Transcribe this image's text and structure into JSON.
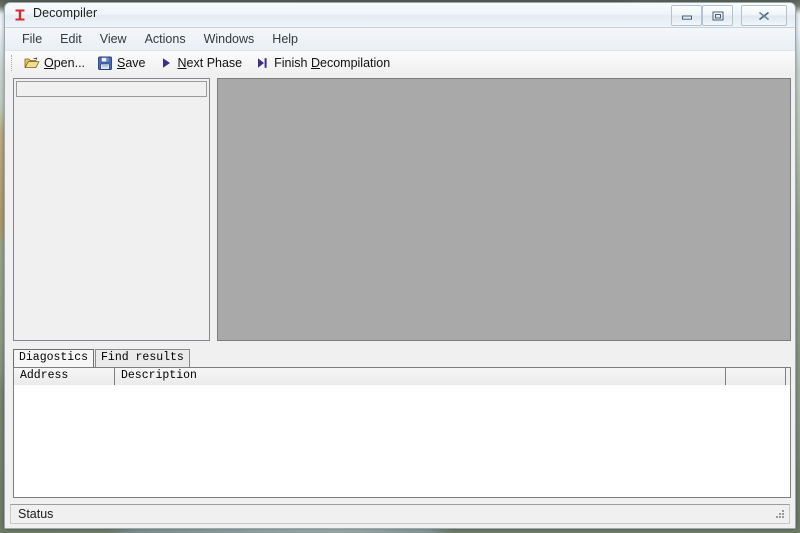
{
  "window": {
    "title": "Decompiler",
    "app_icon": "decompiler-beam-icon",
    "controls": {
      "minimize": "minimize-icon",
      "restore": "restore-icon",
      "close": "close-icon"
    }
  },
  "menubar": {
    "items": [
      {
        "label": "File"
      },
      {
        "label": "Edit"
      },
      {
        "label": "View"
      },
      {
        "label": "Actions"
      },
      {
        "label": "Windows"
      },
      {
        "label": "Help"
      }
    ]
  },
  "toolbar": {
    "buttons": [
      {
        "label": "Open...",
        "mnemonic": "O",
        "icon": "open-folder-icon"
      },
      {
        "label": "Save",
        "mnemonic": "S",
        "icon": "save-floppy-icon"
      },
      {
        "label": "Next Phase",
        "mnemonic": "N",
        "icon": "play-triangle-icon"
      },
      {
        "label": "Finish Decompilation",
        "mnemonic": "D",
        "icon": "skip-to-end-icon"
      }
    ]
  },
  "bottom_panel": {
    "tabs": [
      {
        "label": "Diagostics",
        "active": true
      },
      {
        "label": "Find results",
        "active": false
      }
    ],
    "grid": {
      "columns": [
        {
          "label": "Address"
        },
        {
          "label": "Description"
        },
        {
          "label": ""
        }
      ],
      "rows": []
    }
  },
  "statusbar": {
    "text": "Status",
    "grip": "resize-grip-icon"
  },
  "colors": {
    "main_area": "#a9a9a9",
    "window_face": "#f0f0f0",
    "toolbar_text": "#111111",
    "accent_play": "#3b2f86"
  }
}
